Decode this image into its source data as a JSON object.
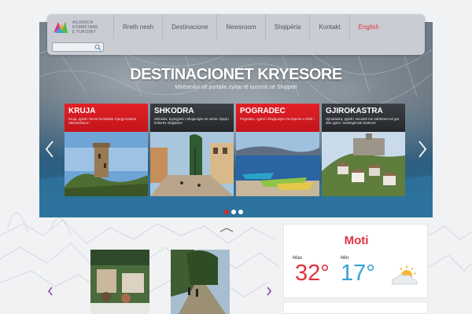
{
  "logo": {
    "lines": [
      "AGJENCIA",
      "KOMBËTARE",
      "E TURIZMIT"
    ]
  },
  "nav": {
    "items": [
      "Rreth nesh",
      "Destinacione",
      "Newsroom",
      "Shqipëria",
      "Kontakt",
      "English"
    ],
    "active_color": "#e0313f"
  },
  "search": {
    "placeholder": ""
  },
  "slider": {
    "title": "DESTINACIONET KRYESORE",
    "subtitle": "Mirësevini në portalin zyrtar të turizmit në Shqipëri",
    "cards": [
      {
        "title": "KRUJA",
        "desc": "Kruja, qyteti i heroit kombëtar Gjergj Kastriot Skënderbeut !",
        "style": "red"
      },
      {
        "title": "SHKODRA",
        "desc": "Shkodra, kryeqyteti i Shqiponjës së veriut. Djepi i kulturës shqiptare!",
        "style": "dark"
      },
      {
        "title": "POGRADEC",
        "desc": "Pogradec, qyteti i Shqiponjës me liqenin e Ohrit !",
        "style": "red"
      },
      {
        "title": "GJIROKASTRA",
        "desc": "Gjirokastra, qyteti i vecantë me ndërtimet në gur dhe qytet i trashëgimisë botërore",
        "style": "dark"
      }
    ],
    "active_slide": 0,
    "slide_count": 3,
    "accent": "#d8262e"
  },
  "weather": {
    "title": "Moti",
    "max_label": "Max",
    "min_label": "Min",
    "max_temp": "32°",
    "min_temp": "17°",
    "icon": "partly-sunny-icon",
    "max_color": "#e0313f",
    "min_color": "#37a0d6"
  }
}
